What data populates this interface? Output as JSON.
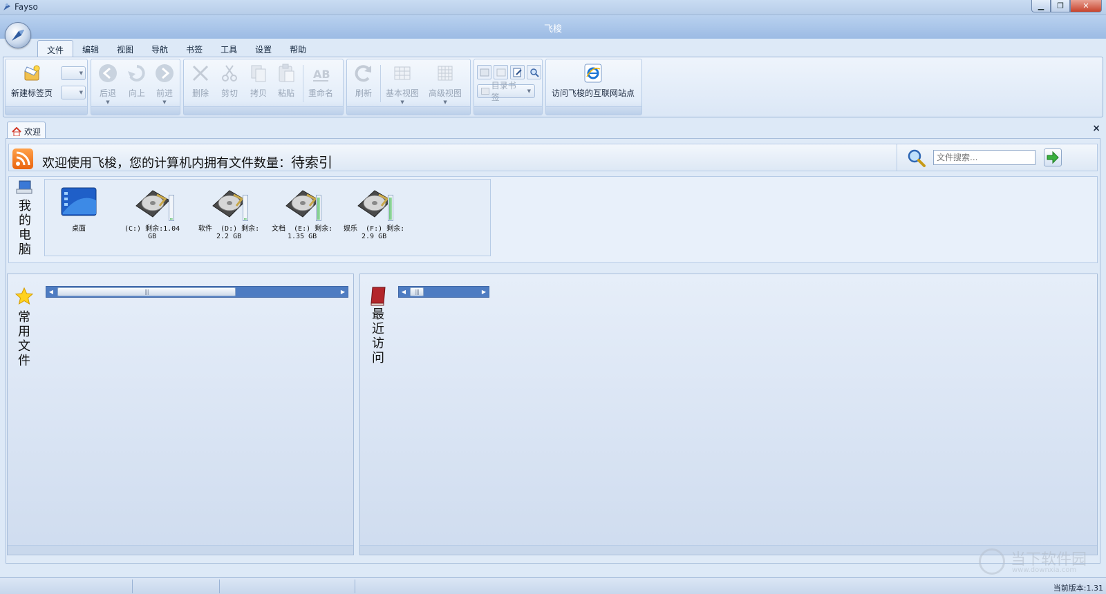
{
  "window": {
    "app_name": "Fayso",
    "title": "飞梭",
    "controls": {
      "minimize": "▁",
      "maximize": "❐",
      "close": "✕"
    }
  },
  "menu": {
    "tabs": [
      "文件",
      "编辑",
      "视图",
      "导航",
      "书签",
      "工具",
      "设置",
      "帮助"
    ],
    "active": "文件"
  },
  "ribbon": {
    "new_tab": "新建标签页",
    "back": "后退",
    "up": "向上",
    "forward": "前进",
    "delete": "删除",
    "cut": "剪切",
    "copy": "拷贝",
    "paste": "粘贴",
    "rename": "重命名",
    "refresh": "刷新",
    "basic_view": "基本视图",
    "advanced_view": "高级视图",
    "dir_bookmark": "目录书签",
    "visit_site": "访问飞梭的互联网站点"
  },
  "doc_tab": {
    "label": "欢迎",
    "close": "×"
  },
  "welcome": {
    "text": "欢迎使用飞梭，您的计算机内拥有文件数量：",
    "status": "待索引",
    "search_placeholder": "文件搜索..."
  },
  "my_computer": {
    "label": "我的电脑",
    "items": [
      {
        "name": "桌面",
        "type": "desktop"
      },
      {
        "name": "(C:) 剩余:1.04\nGB",
        "type": "drive",
        "fill": 0.05
      },
      {
        "name": "软件  (D:) 剩余:\n2.2 GB",
        "type": "drive",
        "fill": 0.05
      },
      {
        "name": "文档  (E:) 剩余:\n1.35 GB",
        "type": "drive",
        "fill": 0.95
      },
      {
        "name": "娱乐  (F:) 剩余:\n2.9 GB",
        "type": "drive",
        "fill": 0.95
      }
    ]
  },
  "frequent": {
    "label": "常用文件"
  },
  "recent": {
    "label": "最近访问"
  },
  "status": {
    "version": "当前版本:1.31"
  },
  "watermark": {
    "text": "当下软件园",
    "url": "www.downxia.com"
  },
  "colors": {
    "accent": "#4e7cc2",
    "rss": "#e9630d",
    "ribbon_bg": "#dbe7f6"
  }
}
